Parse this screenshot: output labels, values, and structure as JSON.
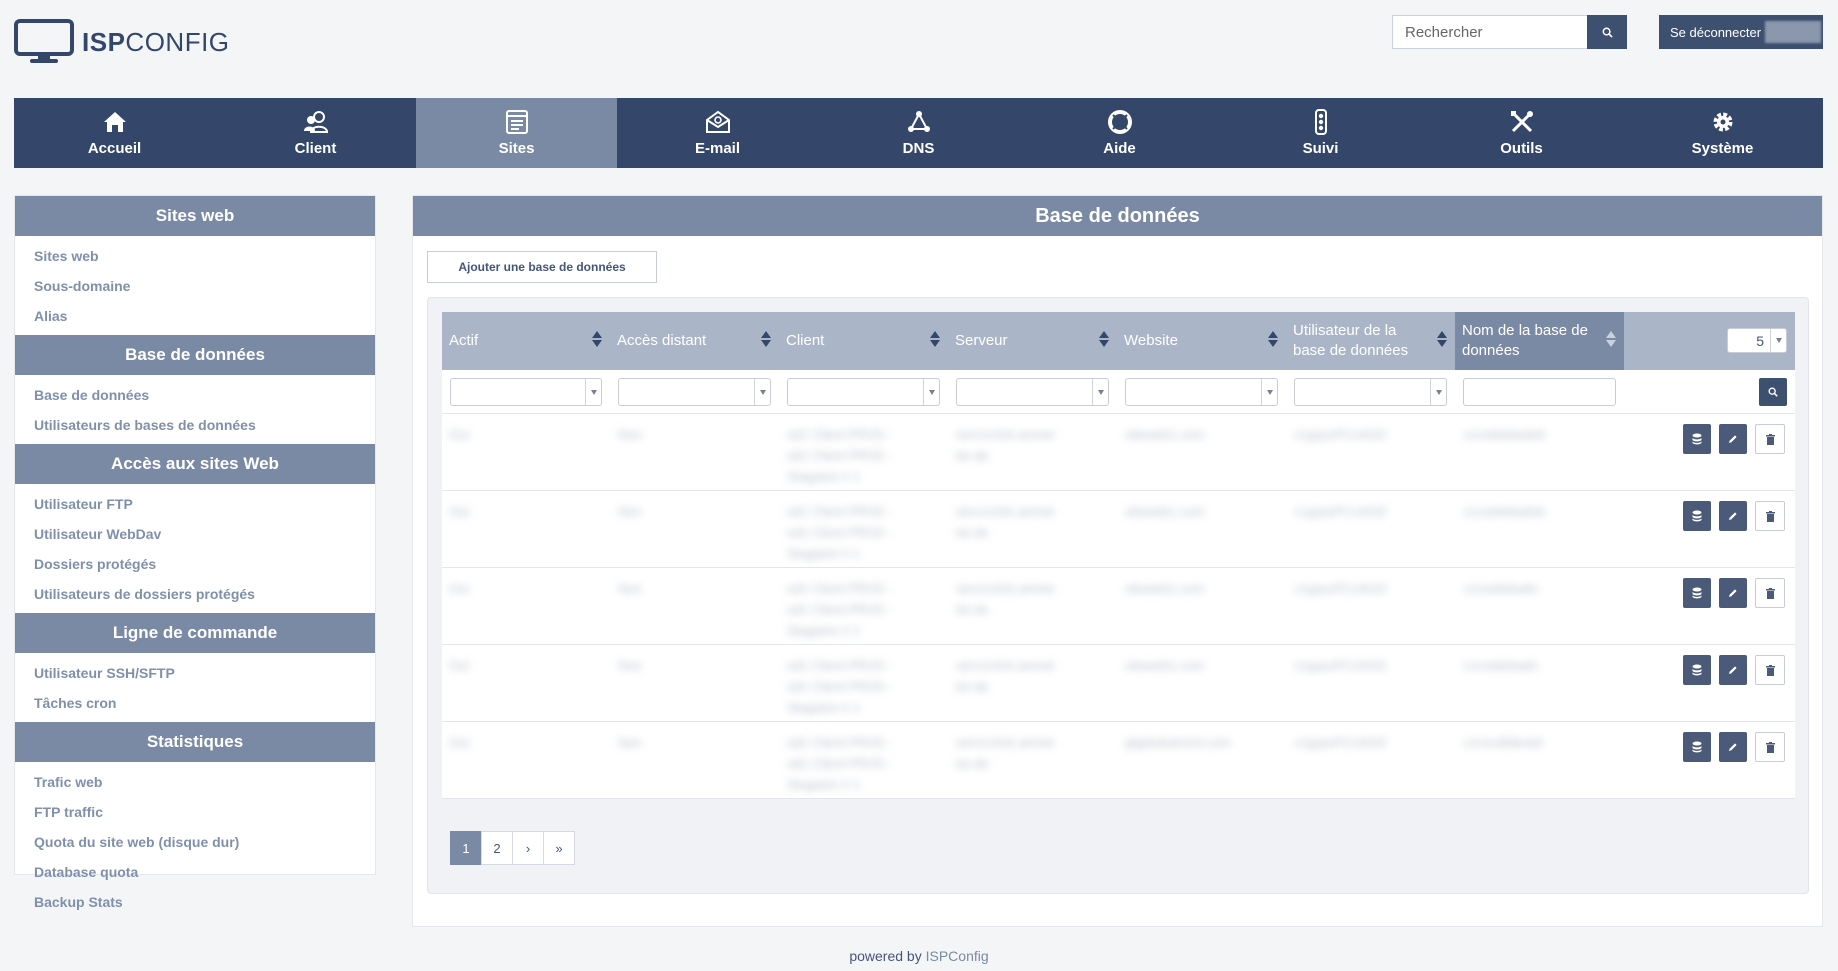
{
  "brand": {
    "logo_bold": "ISP",
    "logo_light": "CONFIG"
  },
  "header": {
    "search_placeholder": "Rechercher",
    "logout_label": "Se déconnecter"
  },
  "topnav": [
    {
      "label": "Accueil",
      "icon": "home-icon"
    },
    {
      "label": "Client",
      "icon": "users-icon"
    },
    {
      "label": "Sites",
      "icon": "sites-icon",
      "active": true
    },
    {
      "label": "E-mail",
      "icon": "mail-icon"
    },
    {
      "label": "DNS",
      "icon": "dns-icon"
    },
    {
      "label": "Aide",
      "icon": "lifebuoy-icon"
    },
    {
      "label": "Suivi",
      "icon": "traffic-light-icon"
    },
    {
      "label": "Outils",
      "icon": "tools-icon"
    },
    {
      "label": "Système",
      "icon": "gear-icon"
    }
  ],
  "sidebar": {
    "sections": [
      {
        "title": "Sites web",
        "items": [
          "Sites web",
          "Sous-domaine",
          "Alias"
        ]
      },
      {
        "title": "Base de données",
        "items": [
          "Base de données",
          "Utilisateurs de bases de données"
        ]
      },
      {
        "title": "Accès aux sites Web",
        "items": [
          "Utilisateur FTP",
          "Utilisateur WebDav",
          "Dossiers protégés",
          "Utilisateurs de dossiers protégés"
        ]
      },
      {
        "title": "Ligne de commande",
        "items": [
          "Utilisateur SSH/SFTP",
          "Tâches cron"
        ]
      },
      {
        "title": "Statistiques",
        "items": [
          "Trafic web",
          "FTP traffic",
          "Quota du site web (disque dur)",
          "Database quota",
          "Backup Stats"
        ]
      }
    ]
  },
  "main": {
    "title": "Base de données",
    "add_button": "Ajouter une base de données",
    "columns": [
      "Actif",
      "Accès distant",
      "Client",
      "Serveur",
      "Website",
      "Utilisateur de la base de données",
      "Nom de la base de données"
    ],
    "per_page": "5",
    "rows": [
      {
        "actif": "Oui",
        "remote": "Non",
        "client": [
          "sd1 Client PRVD -",
          "sd1 Client PRVD -",
          "Stagiaire # 1"
        ],
        "server": [
          "serv1c0ck.amnet",
          "ter.de"
        ],
        "website": "siteweb1.com",
        "user": "c1grpuPCcAGD",
        "dbname": "c1cstdwbadvb"
      },
      {
        "actif": "Oui",
        "remote": "Non",
        "client": [
          "sd1 Client PRVD -",
          "sd1 Client PRVD -",
          "Stagiaire # 1"
        ],
        "server": [
          "serv1c0ck.amnet",
          "ter.de"
        ],
        "website": "siteweb1.com",
        "user": "c1grpuPCcAGD",
        "dbname": "c1cstdwbadvb"
      },
      {
        "actif": "Oui",
        "remote": "Non",
        "client": [
          "sd1 Client PRVD -",
          "sd1 Client PRVD -",
          "Stagiaire # 1"
        ],
        "server": [
          "serv1c0ck.amnet",
          "ter.de"
        ],
        "website": "siteweb1.com",
        "user": "c1grpuPCcAGD",
        "dbname": "c1cstdwbadv"
      },
      {
        "actif": "Oui",
        "remote": "Non",
        "client": [
          "sd1 Client PRVD -",
          "sd1 Client PRVD -",
          "Stagiaire # 1"
        ],
        "server": [
          "serv1c0ck.amnet",
          "ter.de"
        ],
        "website": "siteweb1.com",
        "user": "c1grpuPCcAGD",
        "dbname": "c1cstdwbadv"
      },
      {
        "actif": "Oui",
        "remote": "Non",
        "client": [
          "sd1 Client PRVD -",
          "sd1 Client PRVD -",
          "Stagiaire # 1"
        ],
        "server": [
          "serv1c0ck.amnet",
          "ter.de"
        ],
        "website": "gfgdsdsdcsrd.com",
        "user": "c1grpuPCcAGD",
        "dbname": "c1cscdfdbvbd"
      }
    ],
    "pager": [
      "1",
      "2",
      "›",
      "»"
    ]
  },
  "footer": {
    "prefix": "powered by",
    "brand": "ISPConfig"
  },
  "colors": {
    "navy": "#34466a",
    "slate": "#7a8aa5",
    "light_header": "#aab6c8"
  }
}
